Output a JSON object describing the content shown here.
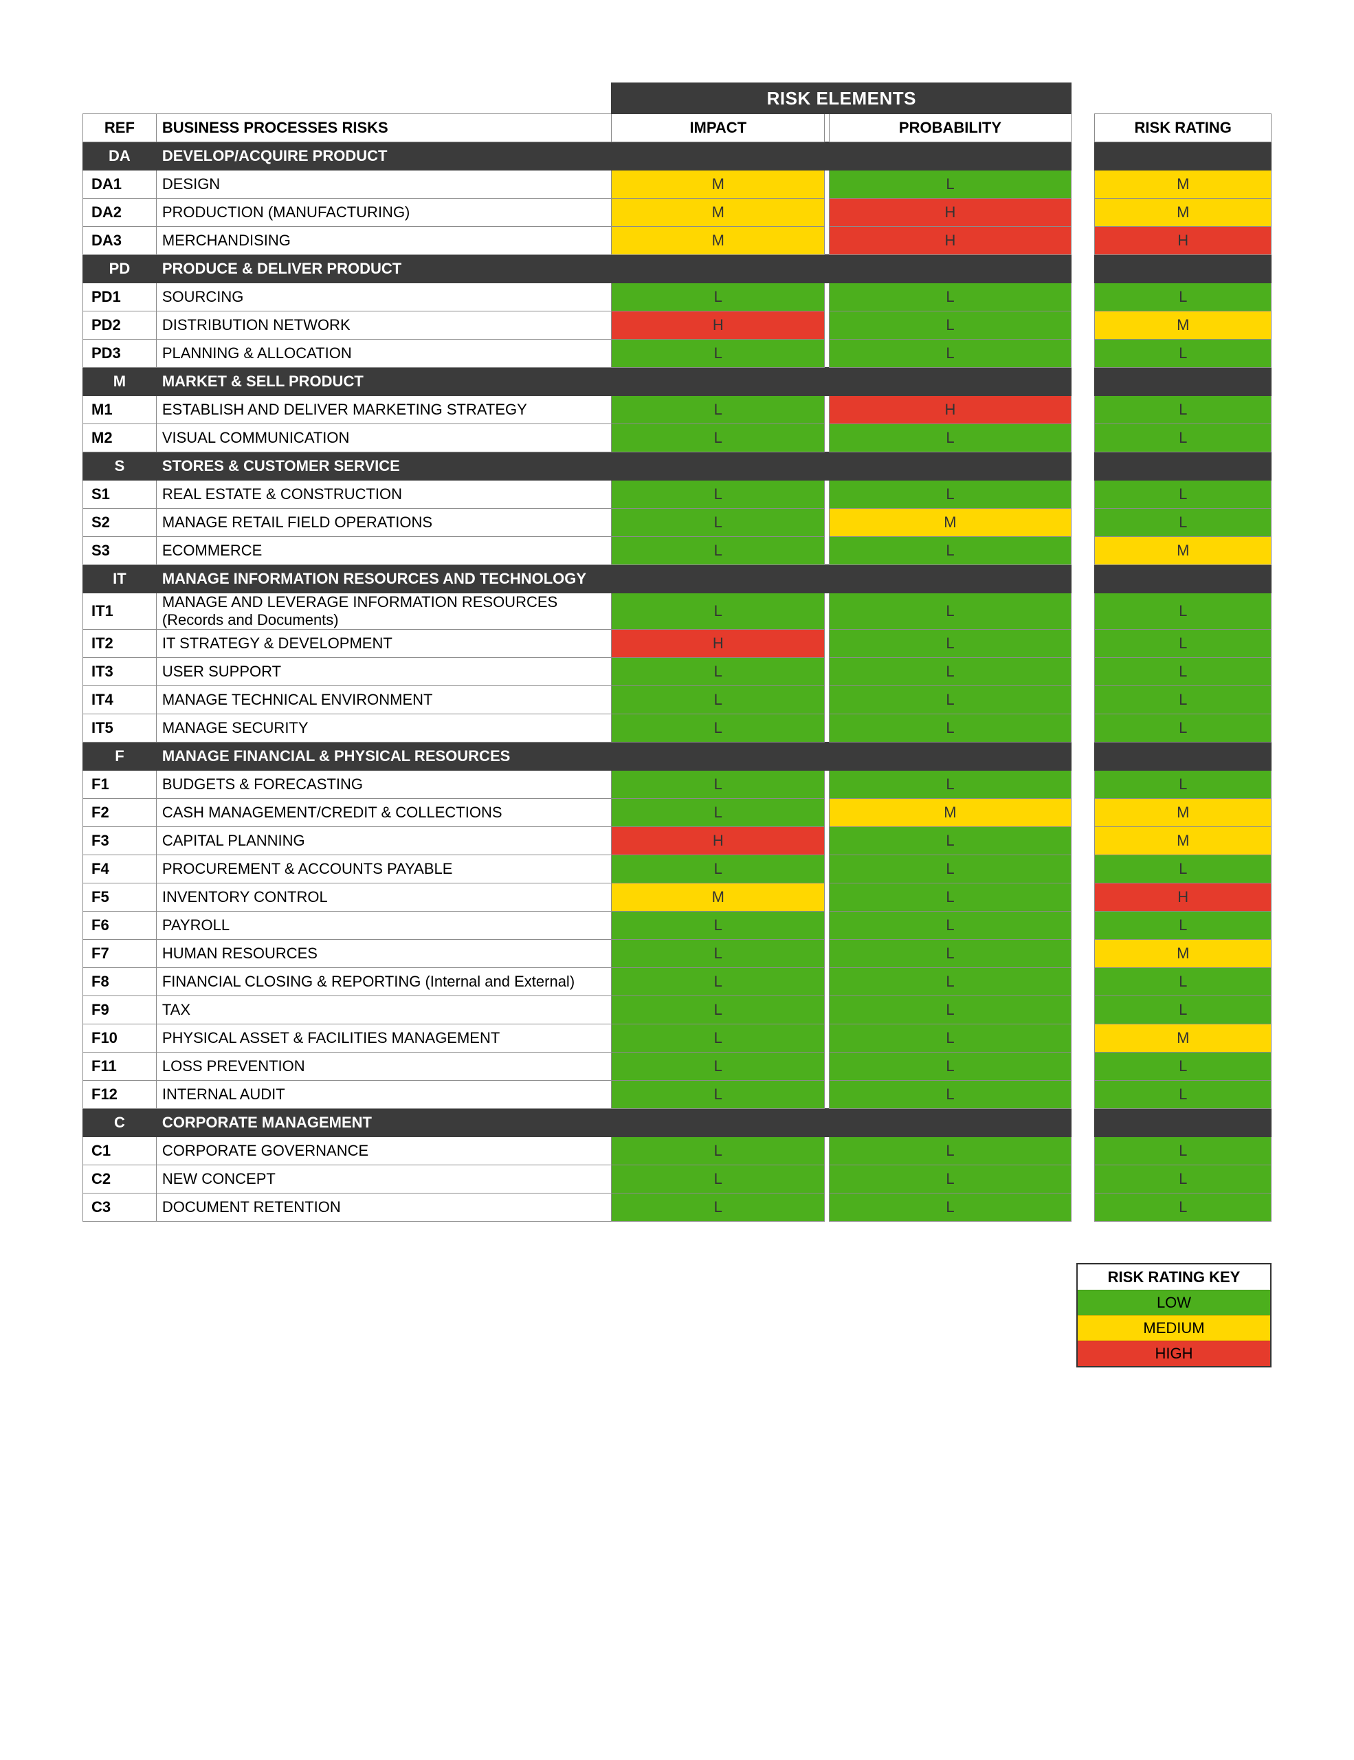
{
  "header": {
    "banner": "RISK ELEMENTS",
    "col_ref": "REF",
    "col_desc": "BUSINESS PROCESSES RISKS",
    "col_impact": "IMPACT",
    "col_probability": "PROBABILITY",
    "col_rating": "RISK RATING"
  },
  "colors": {
    "L": "#4caf1d",
    "M": "#ffd700",
    "H": "#e53b2c",
    "cat_bg": "#3b3b3b"
  },
  "legend": {
    "title": "RISK RATING KEY",
    "low": "LOW",
    "medium": "MEDIUM",
    "high": "HIGH"
  },
  "groups": [
    {
      "code": "DA",
      "name": "DEVELOP/ACQUIRE PRODUCT",
      "rows": [
        {
          "ref": "DA1",
          "desc": "DESIGN",
          "impact": "M",
          "prob": "L",
          "rating": "M"
        },
        {
          "ref": "DA2",
          "desc": "PRODUCTION (MANUFACTURING)",
          "impact": "M",
          "prob": "H",
          "rating": "M"
        },
        {
          "ref": "DA3",
          "desc": "MERCHANDISING",
          "impact": "M",
          "prob": "H",
          "rating": "H"
        }
      ]
    },
    {
      "code": "PD",
      "name": "PRODUCE & DELIVER PRODUCT",
      "rows": [
        {
          "ref": "PD1",
          "desc": "SOURCING",
          "impact": "L",
          "prob": "L",
          "rating": "L"
        },
        {
          "ref": "PD2",
          "desc": "DISTRIBUTION NETWORK",
          "impact": "H",
          "prob": "L",
          "rating": "M"
        },
        {
          "ref": "PD3",
          "desc": "PLANNING & ALLOCATION",
          "impact": "L",
          "prob": "L",
          "rating": "L"
        }
      ]
    },
    {
      "code": "M",
      "name": "MARKET & SELL PRODUCT",
      "rows": [
        {
          "ref": "M1",
          "desc": "ESTABLISH AND DELIVER MARKETING STRATEGY",
          "impact": "L",
          "prob": "H",
          "rating": "L"
        },
        {
          "ref": "M2",
          "desc": "VISUAL COMMUNICATION",
          "impact": "L",
          "prob": "L",
          "rating": "L"
        }
      ]
    },
    {
      "code": "S",
      "name": "STORES & CUSTOMER SERVICE",
      "rows": [
        {
          "ref": "S1",
          "desc": "REAL ESTATE & CONSTRUCTION",
          "impact": "L",
          "prob": "L",
          "rating": "L"
        },
        {
          "ref": "S2",
          "desc": "MANAGE RETAIL FIELD OPERATIONS",
          "impact": "L",
          "prob": "M",
          "rating": "L"
        },
        {
          "ref": "S3",
          "desc": "ECOMMERCE",
          "impact": "L",
          "prob": "L",
          "rating": "M"
        }
      ]
    },
    {
      "code": "IT",
      "name": "MANAGE INFORMATION RESOURCES AND TECHNOLOGY",
      "rows": [
        {
          "ref": "IT1",
          "desc": "MANAGE AND LEVERAGE INFORMATION RESOURCES (Records and Documents)",
          "impact": "L",
          "prob": "L",
          "rating": "L"
        },
        {
          "ref": "IT2",
          "desc": "IT STRATEGY & DEVELOPMENT",
          "impact": "H",
          "prob": "L",
          "rating": "L"
        },
        {
          "ref": "IT3",
          "desc": "USER SUPPORT",
          "impact": "L",
          "prob": "L",
          "rating": "L"
        },
        {
          "ref": "IT4",
          "desc": "MANAGE TECHNICAL ENVIRONMENT",
          "impact": "L",
          "prob": "L",
          "rating": "L"
        },
        {
          "ref": "IT5",
          "desc": "MANAGE SECURITY",
          "impact": "L",
          "prob": "L",
          "rating": "L"
        }
      ]
    },
    {
      "code": "F",
      "name": "MANAGE FINANCIAL & PHYSICAL RESOURCES",
      "rows": [
        {
          "ref": "F1",
          "desc": "BUDGETS & FORECASTING",
          "impact": "L",
          "prob": "L",
          "rating": "L"
        },
        {
          "ref": "F2",
          "desc": "CASH MANAGEMENT/CREDIT & COLLECTIONS",
          "impact": "L",
          "prob": "M",
          "rating": "M"
        },
        {
          "ref": "F3",
          "desc": "CAPITAL PLANNING",
          "impact": "H",
          "prob": "L",
          "rating": "M"
        },
        {
          "ref": "F4",
          "desc": "PROCUREMENT & ACCOUNTS PAYABLE",
          "impact": "L",
          "prob": "L",
          "rating": "L"
        },
        {
          "ref": "F5",
          "desc": "INVENTORY CONTROL",
          "impact": "M",
          "prob": "L",
          "rating": "H"
        },
        {
          "ref": "F6",
          "desc": "PAYROLL",
          "impact": "L",
          "prob": "L",
          "rating": "L"
        },
        {
          "ref": "F7",
          "desc": "HUMAN RESOURCES",
          "impact": "L",
          "prob": "L",
          "rating": "M"
        },
        {
          "ref": "F8",
          "desc": "FINANCIAL CLOSING & REPORTING (Internal and External)",
          "impact": "L",
          "prob": "L",
          "rating": "L"
        },
        {
          "ref": "F9",
          "desc": "TAX",
          "impact": "L",
          "prob": "L",
          "rating": "L"
        },
        {
          "ref": "F10",
          "desc": "PHYSICAL ASSET & FACILITIES MANAGEMENT",
          "impact": "L",
          "prob": "L",
          "rating": "M"
        },
        {
          "ref": "F11",
          "desc": "LOSS PREVENTION",
          "impact": "L",
          "prob": "L",
          "rating": "L"
        },
        {
          "ref": "F12",
          "desc": "INTERNAL AUDIT",
          "impact": "L",
          "prob": "L",
          "rating": "L"
        }
      ]
    },
    {
      "code": "C",
      "name": "CORPORATE MANAGEMENT",
      "rows": [
        {
          "ref": "C1",
          "desc": "CORPORATE GOVERNANCE",
          "impact": "L",
          "prob": "L",
          "rating": "L"
        },
        {
          "ref": "C2",
          "desc": "NEW CONCEPT",
          "impact": "L",
          "prob": "L",
          "rating": "L"
        },
        {
          "ref": "C3",
          "desc": "DOCUMENT RETENTION",
          "impact": "L",
          "prob": "L",
          "rating": "L"
        }
      ]
    }
  ]
}
